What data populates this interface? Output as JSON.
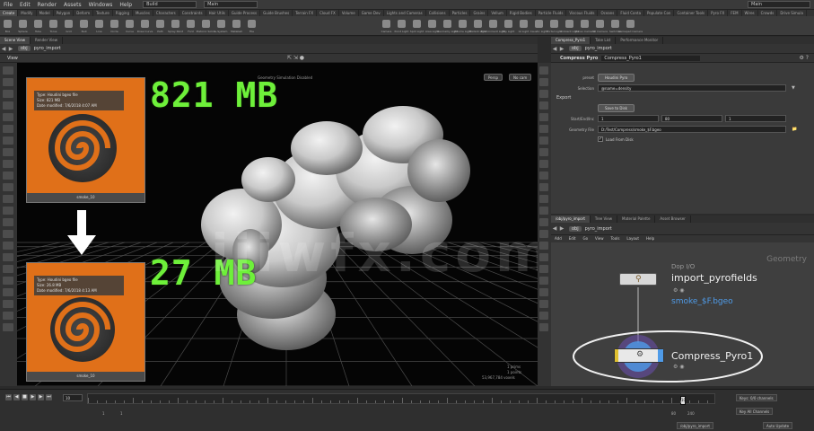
{
  "menubar": {
    "items": [
      "File",
      "Edit",
      "Render",
      "Assets",
      "Windows",
      "Help"
    ],
    "desktop": "Build",
    "desktop2": "Main",
    "right": "Main"
  },
  "shelf_tabs": [
    "Create",
    "Modify",
    "Model",
    "Polygon",
    "Deform",
    "Texture",
    "Rigging",
    "Muscles",
    "Characters",
    "Constraints",
    "Hair Utils",
    "Guide Process",
    "Guide Brushes",
    "Terrain FX",
    "Cloud FX",
    "Volume",
    "Game Dev",
    "Lights and Cameras",
    "Collisions",
    "Particles",
    "Grains",
    "Vellum",
    "Rigid Bodies",
    "Particle Fluids",
    "Viscous Fluids",
    "Oceans",
    "Fluid Conta",
    "Populate Con",
    "Container Tools",
    "Pyro FX",
    "FEM",
    "Wires",
    "Crowds",
    "Drive Simula"
  ],
  "shelf_tools_left": [
    "Box",
    "Sphere",
    "Tube",
    "Torus",
    "Grid",
    "Null",
    "Line",
    "Circle",
    "Curve",
    "Draw Curve",
    "Path",
    "Spray Paint",
    "Font",
    "Platonic Solids",
    "L-System",
    "Metaball",
    "File"
  ],
  "shelf_tools_right": [
    "Camera",
    "Point Light",
    "Spot Light",
    "Area Light",
    "Geometry Light",
    "Volume Light",
    "Distant Light",
    "Environment Light",
    "Sky Light",
    "GI Light",
    "Caustic Light",
    "Portal Light",
    "Ambient Light",
    "Stereo Camera",
    "VR Camera",
    "Switcher",
    "Gamepad Camera"
  ],
  "scene_view": {
    "tabs": [
      "Scene View",
      "Render View"
    ],
    "path": "obj",
    "node": "pyro_import",
    "label": "View",
    "persp": "Persp",
    "cam": "No cam",
    "status": "Geometry Simulation Disabled",
    "stats": [
      "1  prims",
      "1  points",
      "53,967,784  voxels"
    ]
  },
  "cards": [
    {
      "meta": [
        "Type: Houdini bgeo file",
        "Size: 821 MB",
        "Date modified: 7/6/2018 4:07 AM"
      ],
      "caption": "smoke_10"
    },
    {
      "meta": [
        "Type: Houdini bgeo file",
        "Size: 26.8 MB",
        "Date modified: 7/6/2018 4:13 AM"
      ],
      "caption": "smoke_10"
    }
  ],
  "sizes": {
    "before": "821 MB",
    "after": "27 MB"
  },
  "watermark": "iiiwfx.com",
  "params": {
    "tabs": [
      "Compress_Pyro1",
      "Take List",
      "Performance Monitor"
    ],
    "path": "obj",
    "node": "pyro_import",
    "type": "Compress Pyro",
    "name": "Compress_Pyro1",
    "preset_label": "preset",
    "preset_value": "Houdini Pyro",
    "selection_label": "Selection",
    "selection_value": "@name=density",
    "section": "Export",
    "save_button": "Save to Disk",
    "range_label": "Start/End/Inc",
    "range": [
      "1",
      "80",
      "1"
    ],
    "file_label": "Geometry File",
    "file_value": "D:/Test/Compress/smoke_$F.bgeo",
    "load_label": "Load From Disk"
  },
  "network": {
    "tabs": [
      "/obj/pyro_import",
      "Tree View",
      "Material Palette",
      "Asset Browser"
    ],
    "path": "obj",
    "node": "pyro_import",
    "menus": [
      "Add",
      "Edit",
      "Go",
      "View",
      "Tools",
      "Layout",
      "Help"
    ],
    "context": "Geometry",
    "node1_type": "Dop I/O",
    "node1_name": "import_pyrofields",
    "node1_file": "smoke_$F.bgeo",
    "node2_name": "Compress_Pyro1"
  },
  "timeline": {
    "frame": "10",
    "start": "1",
    "start2": "1",
    "end": "80",
    "end2": "240",
    "marker": "10",
    "keys_dd": "Keys: 0/0 channels",
    "channels_dd": "Key All Channels",
    "path_dd": "/obj/pyro_import",
    "update": "Auto Update"
  },
  "colors": {
    "accent_green": "#6ef03a",
    "houdini_orange": "#e07019",
    "node_blue": "#4f9be8"
  }
}
